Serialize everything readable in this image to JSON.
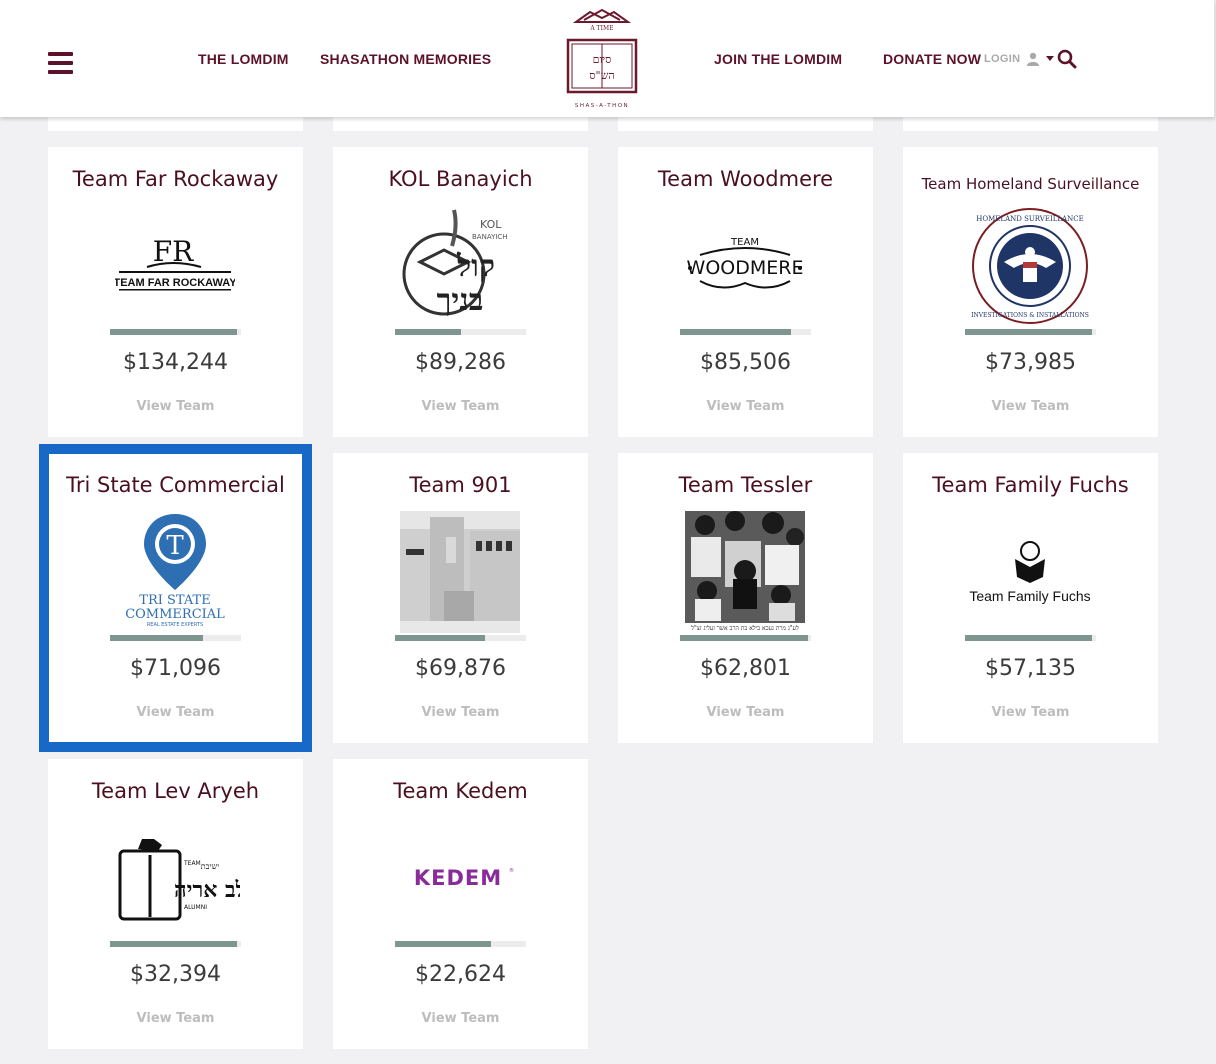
{
  "nav": {
    "items": [
      "THE LOMDIM",
      "SHASATHON MEMORIES",
      "JOIN THE LOMDIM",
      "DONATE NOW"
    ],
    "login": "LOGIN"
  },
  "logo": {
    "top_text": "A TIME",
    "hebrew": "סיום הש\"ס",
    "bottom_text": "SHAS-A-THON"
  },
  "view_label": "View Team",
  "teams": [
    {
      "name": "Team Far Rockaway",
      "amount": "$134,244",
      "progress": 0.97,
      "logo_text": "TEAM FAR ROCKAWAY"
    },
    {
      "name": "KOL Banayich",
      "amount": "$89,286",
      "progress": 0.5,
      "logo_text": "KOL BANAYICH"
    },
    {
      "name": "Team Woodmere",
      "amount": "$85,506",
      "progress": 0.85,
      "logo_text": "WOODMERE"
    },
    {
      "name": "Team Homeland Surveillance",
      "amount": "$73,985",
      "progress": 0.97,
      "logo_text": "HOMELAND SURVEILLANCE"
    },
    {
      "name": "Tri State Commercial",
      "amount": "$71,096",
      "progress": 0.71,
      "logo_text": "TRI STATE COMMERCIAL"
    },
    {
      "name": "Team 901",
      "amount": "$69,876",
      "progress": 0.69,
      "logo_text": ""
    },
    {
      "name": "Team Tessler",
      "amount": "$62,801",
      "progress": 0.98,
      "logo_text": ""
    },
    {
      "name": "Team Family Fuchs",
      "amount": "$57,135",
      "progress": 0.97,
      "logo_text": "Team Family Fuchs"
    },
    {
      "name": "Team Lev Aryeh",
      "amount": "$32,394",
      "progress": 0.97,
      "logo_text": "לב אריה"
    },
    {
      "name": "Team Kedem",
      "amount": "$22,624",
      "progress": 0.73,
      "logo_text": "KEDEM"
    }
  ],
  "colors": {
    "brand": "#5c1228",
    "selected": "#1768c7",
    "progress": "#7f9690"
  }
}
